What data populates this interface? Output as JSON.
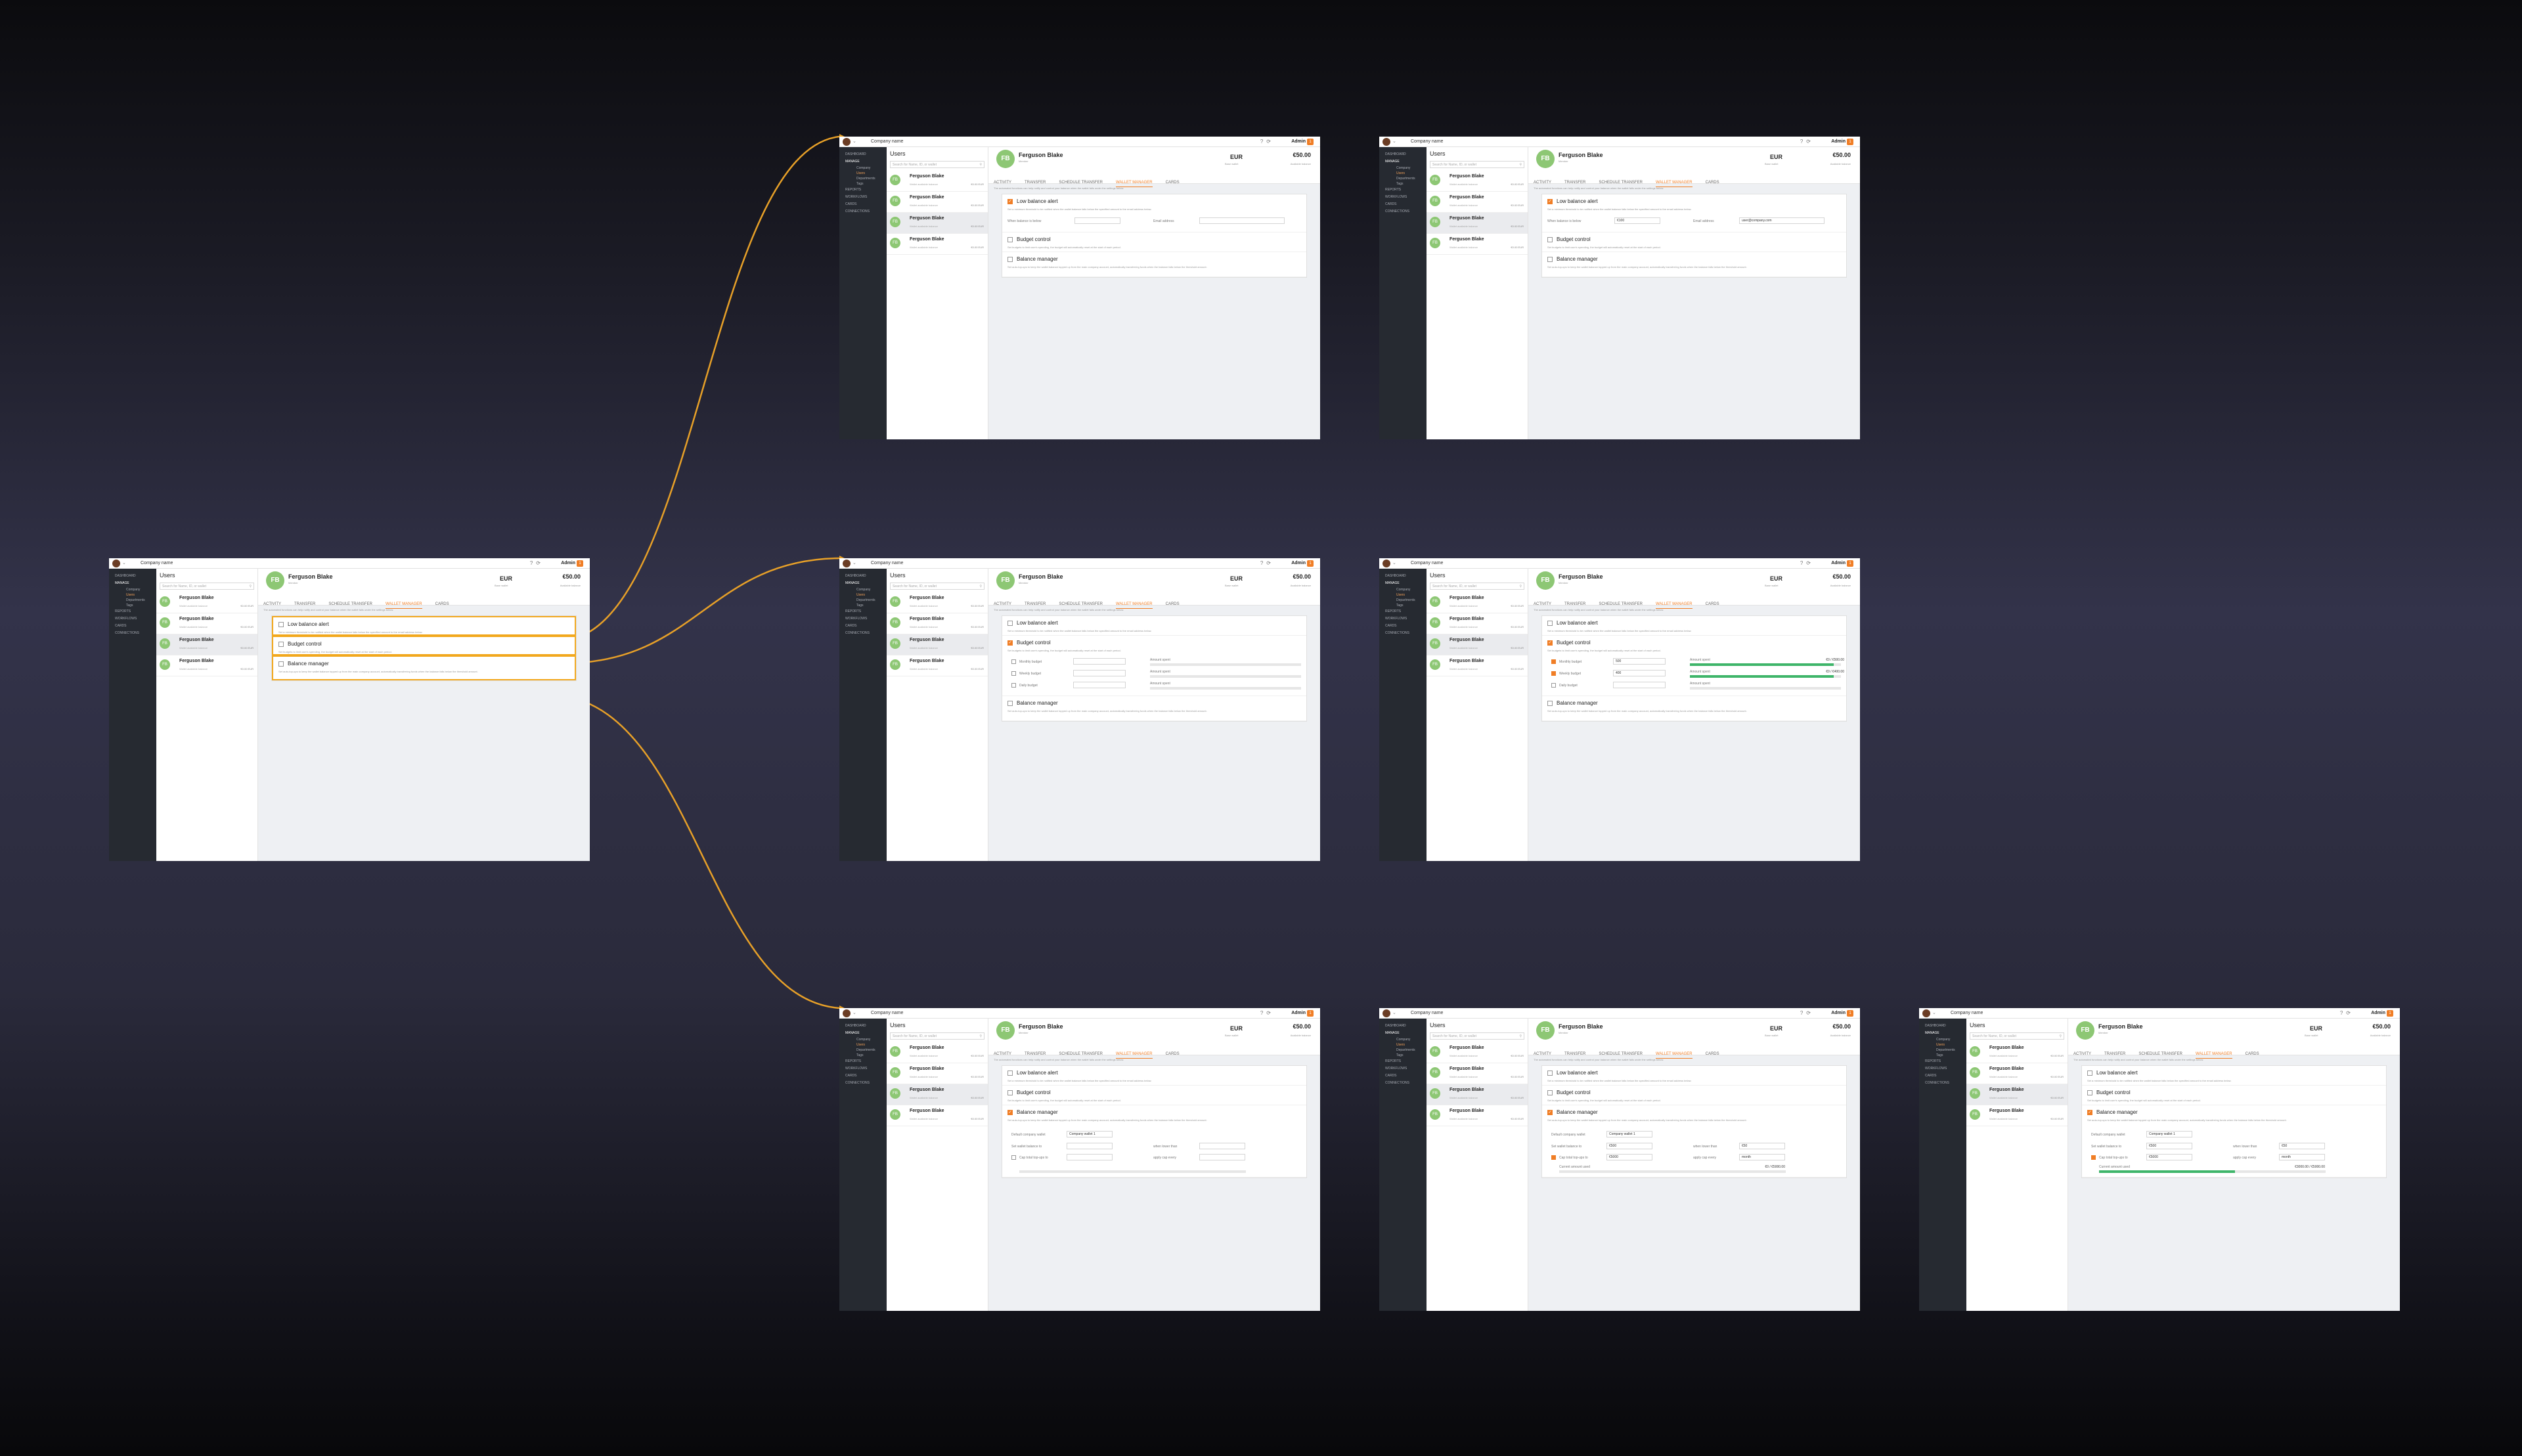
{
  "colors": {
    "accent": "#f07e26",
    "highlight": "#f2a81d",
    "avatar": "#8dc774",
    "progress": "#3fb56a",
    "sidebar": "#262a31"
  },
  "icons": {
    "help": "help-icon",
    "refresh": "refresh-icon",
    "search": "search-icon",
    "checkmark": "checkmark-icon"
  },
  "app": {
    "company": "Company name",
    "admin": "Admin",
    "badge": "1",
    "search_placeholder": "Search for Name, ID, or wallet",
    "users_title": "Users"
  },
  "sidebar": [
    "DASHBOARD",
    "MANAGE",
    "Company",
    "Users",
    "Departments",
    "Tags",
    "REPORTS",
    "WORKFLOWS",
    "CARDS",
    "CONNECTIONS"
  ],
  "users": [
    {
      "initials": "FB",
      "name": "Ferguson Blake",
      "sub": "Wallet available balance",
      "amount": "€0.00 EUR"
    },
    {
      "initials": "FB",
      "name": "Ferguson Blake",
      "sub": "Wallet available balance",
      "amount": "€0.00 EUR"
    },
    {
      "initials": "FB",
      "name": "Ferguson Blake",
      "sub": "Wallet available balance",
      "amount": "€0.00 EUR"
    },
    {
      "initials": "FB",
      "name": "Ferguson Blake",
      "sub": "Wallet available balance",
      "amount": "€0.00 EUR"
    }
  ],
  "profile": {
    "initials": "FB",
    "name": "Ferguson Blake",
    "role": "Member",
    "currency": "EUR",
    "currency_sub": "Base wallet",
    "balance": "€50.00",
    "balance_sub": "Available balance"
  },
  "tabs": [
    "ACTIVITY",
    "TRANSFER",
    "SCHEDULE TRANSFER",
    "WALLET MANAGER",
    "CARDS"
  ],
  "hint": "The automated functions can help notify and control your balance when the wallet falls under the settings below.",
  "sections": {
    "low": {
      "title": "Low balance alert",
      "desc": "Set a minimum threshold to be notified when the wallet balance falls below the specified amount to the email address below.",
      "when": "When balance is below",
      "email": "Email address",
      "amount": "€100",
      "email_value": "user@company.com"
    },
    "budget": {
      "title": "Budget control",
      "desc": "Set budgets to limit user's spending, the budget will automatically reset at the start of each period.",
      "monthly": "Monthly budget",
      "weekly": "Weekly budget",
      "daily": "Daily budget",
      "spent": "Amount spent",
      "monthly_value": "500",
      "weekly_value": "400",
      "monthly_used": "€0 / €500.00",
      "weekly_used": "€0 / €400.00",
      "monthly_pct": 0.95,
      "weekly_pct": 0.95
    },
    "manager": {
      "title": "Balance manager",
      "desc": "Set auto-top-ups to keep the wallet balance topped up from the main company account, automatically transferring funds when the balance falls below the threshold amount.",
      "default": "Default company wallet",
      "wallet": "Company wallet 1",
      "set": "Set wallet balance to",
      "falls": "when lower than",
      "cap": "Cap total top-ups to",
      "apply": "apply cap every",
      "set_value": "€500",
      "falls_value": "€50",
      "cap_value": "€5000",
      "apply_value": "month",
      "used_label": "Current amount used",
      "used_value": "€0 / €5000.00",
      "used_pct": 0.6,
      "used_value_b": "€3000.00 / €5000.00"
    }
  }
}
